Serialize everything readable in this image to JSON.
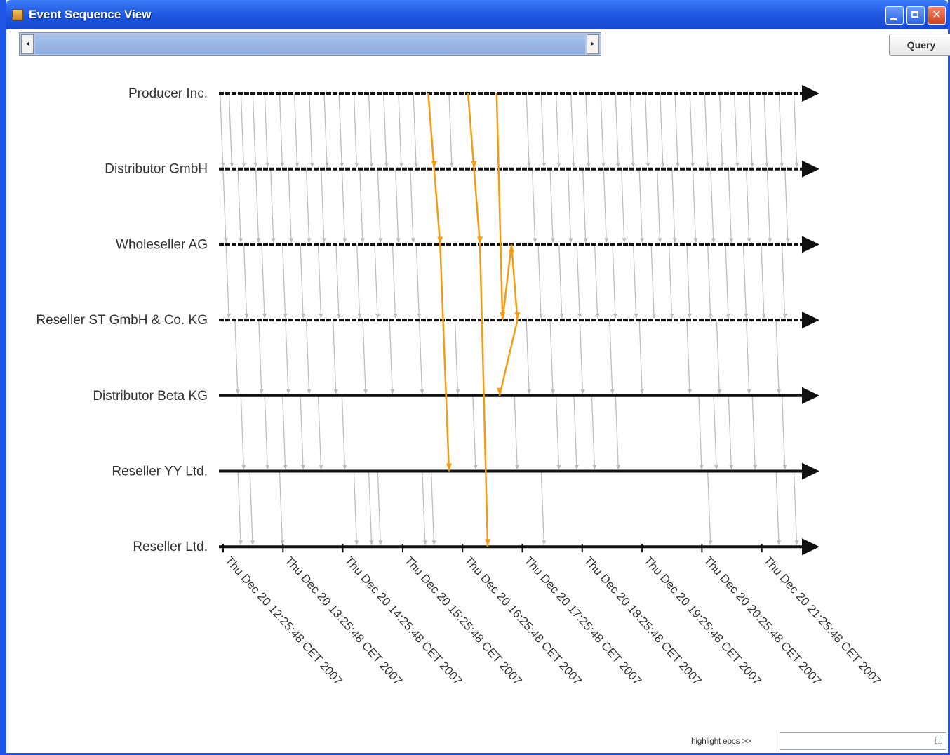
{
  "window": {
    "title": "Event Sequence View"
  },
  "toolbar": {
    "scroll_left": "◂",
    "scroll_right": "▸",
    "query_label": "Query"
  },
  "footer": {
    "highlight_label": "highlight epcs >>",
    "highlight_value": ""
  },
  "colors": {
    "timeline": "#111111",
    "event_line": "#bdbdbd",
    "highlight_line": "#f39c12"
  },
  "chart_data": {
    "type": "line",
    "title": "",
    "lanes": [
      "Producer Inc.",
      "Distributor GmbH",
      "Wholeseller AG",
      "Reseller ST GmbH & Co. KG",
      "Distributor Beta KG",
      "Reseller YY Ltd.",
      "Reseller Ltd."
    ],
    "time_ticks": [
      "Thu Dec 20 12:25:48 CET 2007",
      "Thu Dec 20 13:25:48 CET 2007",
      "Thu Dec 20 14:25:48 CET 2007",
      "Thu Dec 20 15:25:48 CET 2007",
      "Thu Dec 20 16:25:48 CET 2007",
      "Thu Dec 20 17:25:48 CET 2007",
      "Thu Dec 20 18:25:48 CET 2007",
      "Thu Dec 20 19:25:48 CET 2007",
      "Thu Dec 20 20:25:48 CET 2007",
      "Thu Dec 20 21:25:48 CET 2007"
    ],
    "x_range_hours": [
      12.43,
      22.2
    ],
    "grid": false,
    "highlighted_paths": [
      [
        [
          15.95,
          0
        ],
        [
          16.05,
          1
        ],
        [
          16.15,
          2
        ],
        [
          16.3,
          5
        ]
      ],
      [
        [
          16.62,
          0
        ],
        [
          16.72,
          1
        ],
        [
          16.82,
          2
        ],
        [
          16.95,
          6
        ]
      ],
      [
        [
          17.1,
          0
        ],
        [
          17.2,
          3
        ],
        [
          17.35,
          2
        ],
        [
          17.45,
          3
        ],
        [
          17.15,
          4
        ]
      ]
    ],
    "event_transitions": [
      [
        12.45,
        0,
        1
      ],
      [
        12.6,
        0,
        1
      ],
      [
        12.8,
        0,
        1
      ],
      [
        13.0,
        0,
        1
      ],
      [
        13.2,
        0,
        1
      ],
      [
        13.45,
        0,
        1
      ],
      [
        13.7,
        0,
        1
      ],
      [
        13.95,
        0,
        1
      ],
      [
        14.2,
        0,
        1
      ],
      [
        14.45,
        0,
        1
      ],
      [
        14.7,
        0,
        1
      ],
      [
        14.95,
        0,
        1
      ],
      [
        15.2,
        0,
        1
      ],
      [
        15.45,
        0,
        1
      ],
      [
        15.7,
        0,
        1
      ],
      [
        16.3,
        0,
        1
      ],
      [
        17.6,
        0,
        1
      ],
      [
        17.85,
        0,
        1
      ],
      [
        18.1,
        0,
        1
      ],
      [
        18.35,
        0,
        1
      ],
      [
        18.6,
        0,
        1
      ],
      [
        18.85,
        0,
        1
      ],
      [
        19.1,
        0,
        1
      ],
      [
        19.35,
        0,
        1
      ],
      [
        19.6,
        0,
        1
      ],
      [
        19.85,
        0,
        1
      ],
      [
        20.1,
        0,
        1
      ],
      [
        20.35,
        0,
        1
      ],
      [
        20.6,
        0,
        1
      ],
      [
        20.85,
        0,
        1
      ],
      [
        21.1,
        0,
        1
      ],
      [
        21.35,
        0,
        1
      ],
      [
        21.6,
        0,
        1
      ],
      [
        21.85,
        0,
        1
      ],
      [
        22.1,
        0,
        1
      ],
      [
        12.5,
        1,
        2
      ],
      [
        12.75,
        1,
        2
      ],
      [
        13.05,
        1,
        2
      ],
      [
        13.3,
        1,
        2
      ],
      [
        13.6,
        1,
        2
      ],
      [
        13.9,
        1,
        2
      ],
      [
        14.15,
        1,
        2
      ],
      [
        14.5,
        1,
        2
      ],
      [
        14.8,
        1,
        2
      ],
      [
        15.1,
        1,
        2
      ],
      [
        15.4,
        1,
        2
      ],
      [
        15.65,
        1,
        2
      ],
      [
        17.7,
        1,
        2
      ],
      [
        18.0,
        1,
        2
      ],
      [
        18.3,
        1,
        2
      ],
      [
        18.55,
        1,
        2
      ],
      [
        18.9,
        1,
        2
      ],
      [
        19.2,
        1,
        2
      ],
      [
        19.5,
        1,
        2
      ],
      [
        19.8,
        1,
        2
      ],
      [
        20.05,
        1,
        2
      ],
      [
        20.4,
        1,
        2
      ],
      [
        20.7,
        1,
        2
      ],
      [
        21.0,
        1,
        2
      ],
      [
        21.3,
        1,
        2
      ],
      [
        21.65,
        1,
        2
      ],
      [
        21.95,
        1,
        2
      ],
      [
        12.55,
        2,
        3
      ],
      [
        12.85,
        2,
        3
      ],
      [
        13.15,
        2,
        3
      ],
      [
        13.5,
        2,
        3
      ],
      [
        13.8,
        2,
        3
      ],
      [
        14.1,
        2,
        3
      ],
      [
        14.4,
        2,
        3
      ],
      [
        14.75,
        2,
        3
      ],
      [
        15.05,
        2,
        3
      ],
      [
        15.35,
        2,
        3
      ],
      [
        15.75,
        2,
        3
      ],
      [
        17.8,
        2,
        3
      ],
      [
        18.15,
        2,
        3
      ],
      [
        18.45,
        2,
        3
      ],
      [
        18.75,
        2,
        3
      ],
      [
        19.05,
        2,
        3
      ],
      [
        19.4,
        2,
        3
      ],
      [
        19.7,
        2,
        3
      ],
      [
        20.0,
        2,
        3
      ],
      [
        20.3,
        2,
        3
      ],
      [
        20.65,
        2,
        3
      ],
      [
        20.95,
        2,
        3
      ],
      [
        21.25,
        2,
        3
      ],
      [
        21.55,
        2,
        3
      ],
      [
        21.9,
        2,
        3
      ],
      [
        12.7,
        3,
        4
      ],
      [
        13.1,
        3,
        4
      ],
      [
        13.55,
        3,
        4
      ],
      [
        13.9,
        3,
        4
      ],
      [
        14.35,
        3,
        4
      ],
      [
        14.85,
        3,
        4
      ],
      [
        15.3,
        3,
        4
      ],
      [
        15.8,
        3,
        4
      ],
      [
        16.4,
        3,
        4
      ],
      [
        17.6,
        3,
        4
      ],
      [
        18.0,
        3,
        4
      ],
      [
        18.5,
        3,
        4
      ],
      [
        19.0,
        3,
        4
      ],
      [
        19.5,
        3,
        4
      ],
      [
        20.3,
        3,
        4
      ],
      [
        20.8,
        3,
        4
      ],
      [
        21.3,
        3,
        4
      ],
      [
        21.8,
        3,
        4
      ],
      [
        12.8,
        4,
        5
      ],
      [
        13.2,
        4,
        5
      ],
      [
        13.5,
        4,
        5
      ],
      [
        13.8,
        4,
        5
      ],
      [
        14.1,
        4,
        5
      ],
      [
        14.5,
        4,
        5
      ],
      [
        16.7,
        4,
        5
      ],
      [
        17.4,
        4,
        5
      ],
      [
        18.1,
        4,
        5
      ],
      [
        18.4,
        4,
        5
      ],
      [
        18.7,
        4,
        5
      ],
      [
        19.1,
        4,
        5
      ],
      [
        20.5,
        4,
        5
      ],
      [
        20.75,
        4,
        5
      ],
      [
        21.0,
        4,
        5
      ],
      [
        21.4,
        4,
        5
      ],
      [
        21.9,
        4,
        5
      ],
      [
        12.75,
        5,
        6
      ],
      [
        12.95,
        5,
        6
      ],
      [
        13.45,
        5,
        6
      ],
      [
        14.7,
        5,
        6
      ],
      [
        14.95,
        5,
        6
      ],
      [
        15.1,
        5,
        6
      ],
      [
        15.85,
        5,
        6
      ],
      [
        16.0,
        5,
        6
      ],
      [
        17.85,
        5,
        6
      ],
      [
        20.65,
        5,
        6
      ],
      [
        21.8,
        5,
        6
      ],
      [
        22.1,
        5,
        6
      ]
    ]
  }
}
